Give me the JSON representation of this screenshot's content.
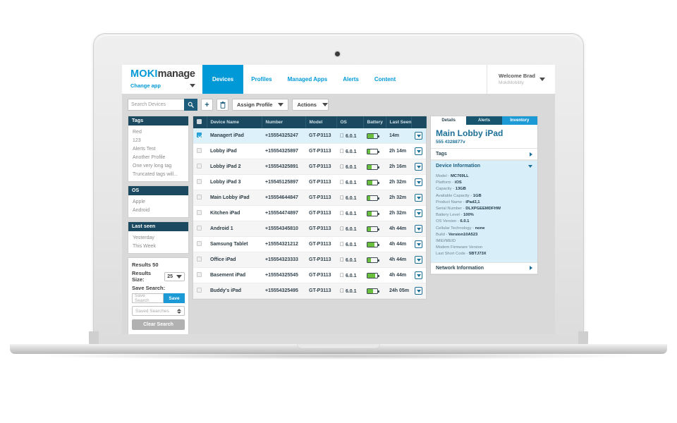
{
  "brand": {
    "part1": "MOKI",
    "part2": "manage",
    "change_app": "Change app"
  },
  "nav": {
    "items": [
      {
        "label": "Devices",
        "active": true
      },
      {
        "label": "Profiles",
        "active": false
      },
      {
        "label": "Managed Apps",
        "active": false
      },
      {
        "label": "Alerts",
        "active": false
      },
      {
        "label": "Content",
        "active": false
      }
    ]
  },
  "user": {
    "welcome": "Welcome Brad",
    "org": "MokiMobility"
  },
  "toolbar": {
    "search_placeholder": "Search Devices",
    "search_icon": "search-icon",
    "add_icon": "plus-icon",
    "delete_icon": "trash-icon",
    "assign_profile": "Assign Profile",
    "actions": "Actions"
  },
  "filters": {
    "tags": {
      "title": "Tags",
      "items": [
        "Red",
        "123",
        "Alerts Test",
        "Another Profile",
        "One very long tag",
        "Truncated tags will..."
      ]
    },
    "os": {
      "title": "OS",
      "items": [
        "Apple",
        "Android"
      ]
    },
    "last_seen": {
      "title": "Last seen",
      "items": [
        "Yesterday",
        "This Week"
      ]
    },
    "results": {
      "results_label": "Results 50",
      "results_size_label": "Results Size:",
      "results_size_value": "25",
      "save_search_label": "Save Search:",
      "save_search_placeholder": "Save Search",
      "save_button": "Save",
      "saved_searches_placeholder": "Saved Searches",
      "clear_button": "Clear Search"
    }
  },
  "table": {
    "columns": [
      "",
      "Device Name",
      "Number",
      "Model",
      "OS",
      "Battery",
      "Last Seen",
      ""
    ],
    "rows": [
      {
        "checked": true,
        "name": "Managert iPad",
        "number": "+15554325247",
        "model": "GT-P3113",
        "os": "6.0.1",
        "battery": 62,
        "last_seen": "14m"
      },
      {
        "checked": false,
        "name": "Lobby iPad",
        "number": "+15554325897",
        "model": "GT-P3113",
        "os": "6.0.1",
        "battery": 30,
        "last_seen": "2h 14m"
      },
      {
        "checked": false,
        "name": "Lobby iPad 2",
        "number": "+15554325891",
        "model": "GT-P3113",
        "os": "6.0.1",
        "battery": 45,
        "last_seen": "2h 16m"
      },
      {
        "checked": false,
        "name": "Lobby iPad 3",
        "number": "+15545125897",
        "model": "GT-P3113",
        "os": "6.0.1",
        "battery": 52,
        "last_seen": "2h 32m"
      },
      {
        "checked": false,
        "name": "Main Lobby iPad",
        "number": "+15554644847",
        "model": "GT-P3113",
        "os": "6.0.1",
        "battery": 28,
        "last_seen": "2h 32m"
      },
      {
        "checked": false,
        "name": "Kitchen iPad",
        "number": "+15554474897",
        "model": "GT-P3113",
        "os": "6.0.1",
        "battery": 40,
        "last_seen": "2h 32m"
      },
      {
        "checked": false,
        "name": "Android 1",
        "number": "+15554345810",
        "model": "GT-P3113",
        "os": "6.0.1",
        "battery": 35,
        "last_seen": "4h 44m"
      },
      {
        "checked": false,
        "name": "Samsung Tablet",
        "number": "+15554321212",
        "model": "GT-P3113",
        "os": "6.0.1",
        "battery": 70,
        "last_seen": "4h 44m"
      },
      {
        "checked": false,
        "name": "Office iPad",
        "number": "+15554323333",
        "model": "GT-P3113",
        "os": "6.0.1",
        "battery": 33,
        "last_seen": "4h 44m"
      },
      {
        "checked": false,
        "name": "Basement iPad",
        "number": "+15554325545",
        "model": "GT-P3113",
        "os": "6.0.1",
        "battery": 75,
        "last_seen": "4h 44m"
      },
      {
        "checked": false,
        "name": "Buddy's iPad",
        "number": "+15554325495",
        "model": "GT-P3113",
        "os": "6.0.1",
        "battery": 55,
        "last_seen": "24h 05m"
      }
    ]
  },
  "details": {
    "tabs": [
      {
        "label": "Details",
        "state": "active"
      },
      {
        "label": "Alerts",
        "state": "dark"
      },
      {
        "label": "Inventory",
        "state": "light"
      }
    ],
    "title": "Main Lobby iPad",
    "subtitle": "555 4328877v",
    "tags_section": "Tags",
    "device_info_section": "Device Information",
    "network_section": "Network Information",
    "info": [
      {
        "label": "Model",
        "value": "MC769LL"
      },
      {
        "label": "Platform",
        "value": "iOS"
      },
      {
        "label": "Capacity",
        "value": "13GB"
      },
      {
        "label": "Available Capacity",
        "value": "1GB"
      },
      {
        "label": "Product Name",
        "value": "iPad2,1"
      },
      {
        "label": "Serial Number",
        "value": "DLXPGEEMDFHW"
      },
      {
        "label": "Battery Level",
        "value": "100%"
      },
      {
        "label": "OS Version",
        "value": "6.0.1"
      },
      {
        "label": "Cellular Technology",
        "value": "none"
      },
      {
        "label": "Build",
        "value": "Version10A523"
      },
      {
        "label": "IMEI/MEID",
        "value": ""
      },
      {
        "label": "Modem Firmware Version",
        "value": ""
      },
      {
        "label": "Last Short Code",
        "value": "5BTJ73X"
      }
    ]
  },
  "colors": {
    "brand_blue": "#0099d8",
    "dark_teal": "#1b4a60",
    "accent_blue": "#1b9ad6",
    "battery_green": "#6bbf3f",
    "selected_row": "#ddf1fb"
  }
}
